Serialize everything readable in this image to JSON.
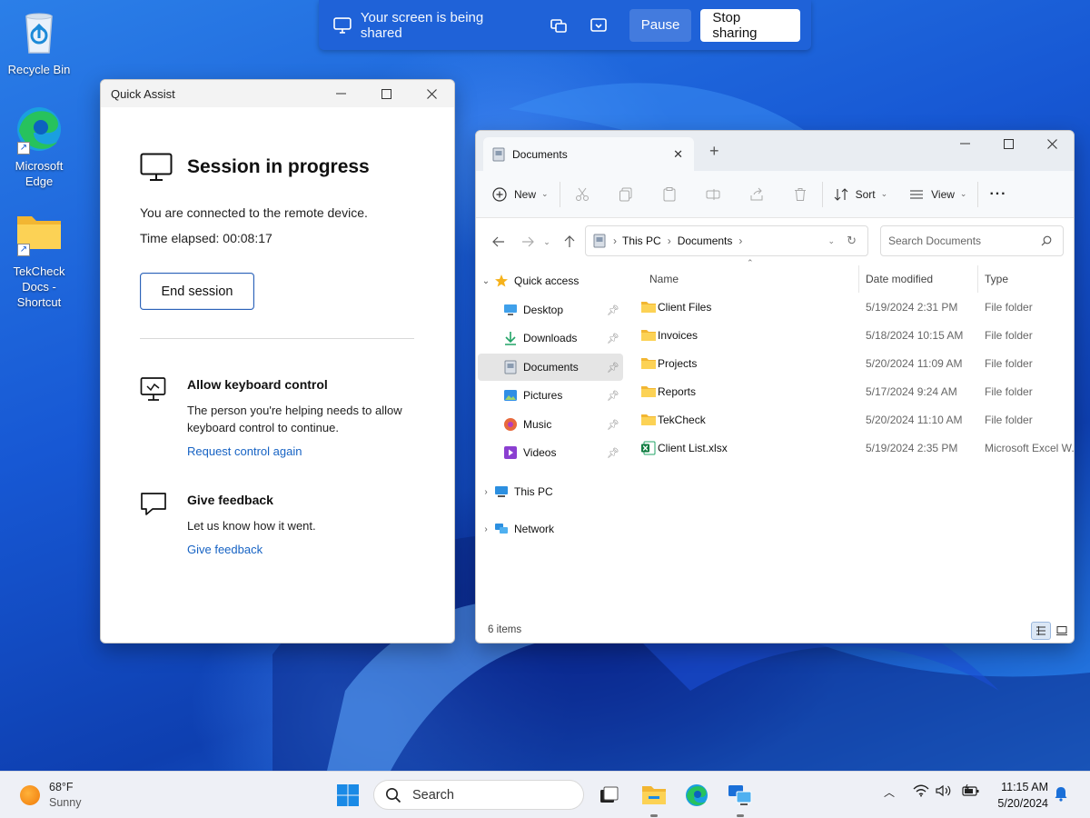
{
  "desktop": {
    "icons": [
      {
        "label": "Recycle Bin"
      },
      {
        "label": "Microsoft Edge"
      },
      {
        "label": "TekCheck Docs - Shortcut"
      }
    ]
  },
  "sharebar": {
    "status_text": "Your screen is being shared",
    "pause_label": "Pause",
    "stop_label": "Stop sharing"
  },
  "quick_assist": {
    "window_title": "Quick Assist",
    "heading": "Session in progress",
    "connected_text": "You are connected to the remote device.",
    "time_elapsed": "Time elapsed: 00:08:17",
    "end_session_label": "End session",
    "keyboard": {
      "title": "Allow keyboard control",
      "description": "The person you're helping needs to allow keyboard control to continue.",
      "link": "Request control again"
    },
    "feedback": {
      "title": "Give feedback",
      "description": "Let us know how it went.",
      "link": "Give feedback"
    }
  },
  "explorer": {
    "tab_title": "Documents",
    "toolbar": {
      "new_label": "New",
      "sort_label": "Sort",
      "view_label": "View",
      "more_label": "···"
    },
    "breadcrumb": [
      "This PC",
      "Documents"
    ],
    "search_placeholder": "Search Documents",
    "nav": [
      {
        "label": "Quick access",
        "icon": "star-icon"
      },
      {
        "label": "Desktop",
        "icon": "desktop-icon"
      },
      {
        "label": "Downloads",
        "icon": "download-icon"
      },
      {
        "label": "Documents",
        "icon": "documents-icon",
        "selected": true
      },
      {
        "label": "Pictures",
        "icon": "pictures-icon"
      },
      {
        "label": "Music",
        "icon": "music-icon"
      },
      {
        "label": "Videos",
        "icon": "videos-icon"
      },
      {
        "label": "This PC",
        "icon": "pc-icon"
      },
      {
        "label": "Network",
        "icon": "network-icon"
      }
    ],
    "columns": {
      "name": "Name",
      "date": "Date modified",
      "type": "Type"
    },
    "files": [
      {
        "name": "Client Files",
        "date": "5/19/2024 2:31 PM",
        "type": "File folder",
        "icon": "folder-icon"
      },
      {
        "name": "Invoices",
        "date": "5/18/2024 10:15 AM",
        "type": "File folder",
        "icon": "folder-icon"
      },
      {
        "name": "Projects",
        "date": "5/20/2024 11:09 AM",
        "type": "File folder",
        "icon": "folder-icon"
      },
      {
        "name": "Reports",
        "date": "5/17/2024 9:24 AM",
        "type": "File folder",
        "icon": "folder-icon"
      },
      {
        "name": "TekCheck",
        "date": "5/20/2024 11:10 AM",
        "type": "File folder",
        "icon": "folder-icon"
      },
      {
        "name": "Client List.xlsx",
        "date": "5/19/2024 2:35 PM",
        "type": "Microsoft Excel W...",
        "icon": "excel-icon"
      }
    ],
    "status_count": "6 items"
  },
  "taskbar": {
    "weather_temp": "68°F",
    "weather_condition": "Sunny",
    "search_label": "Search",
    "clock_time": "11:15 AM",
    "clock_date": "5/20/2024"
  },
  "colors": {
    "accent": "#1f62d8",
    "link": "#1763c4",
    "folder": "#f4c542"
  }
}
